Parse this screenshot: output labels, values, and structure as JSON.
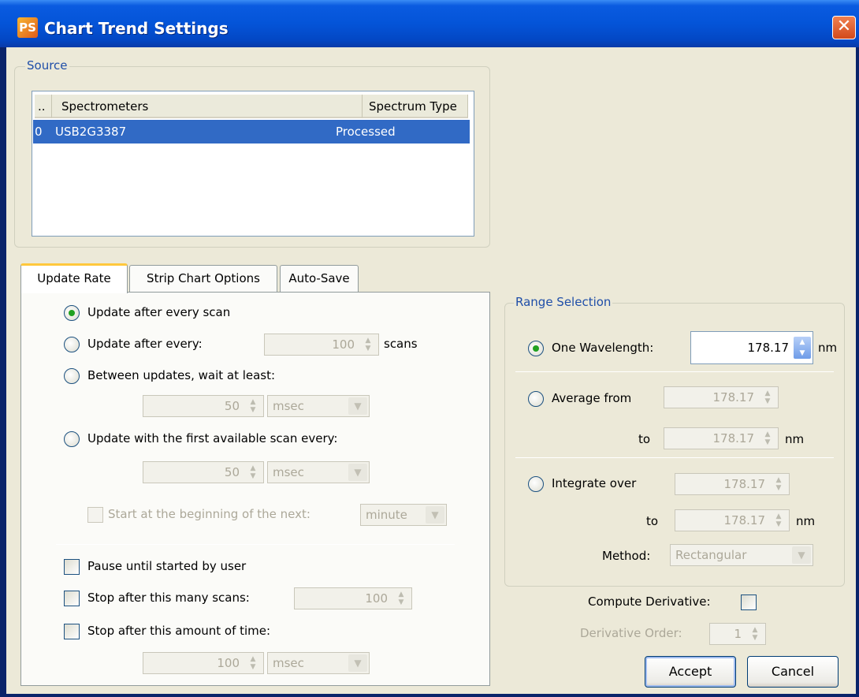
{
  "window": {
    "title": "Chart Trend Settings",
    "icon_text": "PS",
    "close_glyph": "✕"
  },
  "source": {
    "legend": "Source",
    "columns": [
      "..",
      "Spectrometers",
      "Spectrum Type"
    ],
    "rows": [
      {
        "index": "0",
        "spectrometer": "USB2G3387",
        "type": "Processed"
      }
    ]
  },
  "tabs": [
    "Update Rate",
    "Strip Chart Options",
    "Auto-Save"
  ],
  "update_rate": {
    "opt_every_scan": "Update after every scan",
    "opt_every": "Update after every:",
    "every_value": "100",
    "every_unit": "scans",
    "opt_wait": "Between updates, wait at least:",
    "wait_value": "50",
    "wait_unit": "msec",
    "opt_first": "Update with the first available scan every:",
    "first_value": "50",
    "first_unit": "msec",
    "start_label": "Start at the beginning of the next:",
    "start_unit": "minute",
    "pause_label": "Pause until started by user",
    "stop_scans_label": "Stop after this many scans:",
    "stop_scans_value": "100",
    "stop_time_label": "Stop after this amount of time:",
    "stop_time_value": "100",
    "stop_time_unit": "msec",
    "selected": "Update after every scan"
  },
  "range": {
    "legend": "Range Selection",
    "one_label": "One Wavelength:",
    "one_value": "178.17",
    "nm": "nm",
    "avg_label": "Average from",
    "avg_from": "178.17",
    "to": "to",
    "avg_to": "178.17",
    "int_label": "Integrate over",
    "int_from": "178.17",
    "int_to": "178.17",
    "method_label": "Method:",
    "method_value": "Rectangular",
    "selected": "One Wavelength:"
  },
  "derivative": {
    "compute_label": "Compute Derivative:",
    "order_label": "Derivative Order:",
    "order_value": "1"
  },
  "buttons": {
    "accept": "Accept",
    "cancel": "Cancel"
  },
  "colors": {
    "title_bar": "#0454d8",
    "selection": "#316ac5",
    "group_title": "#1f4ea8",
    "dialog_bg": "#ece9d8"
  }
}
